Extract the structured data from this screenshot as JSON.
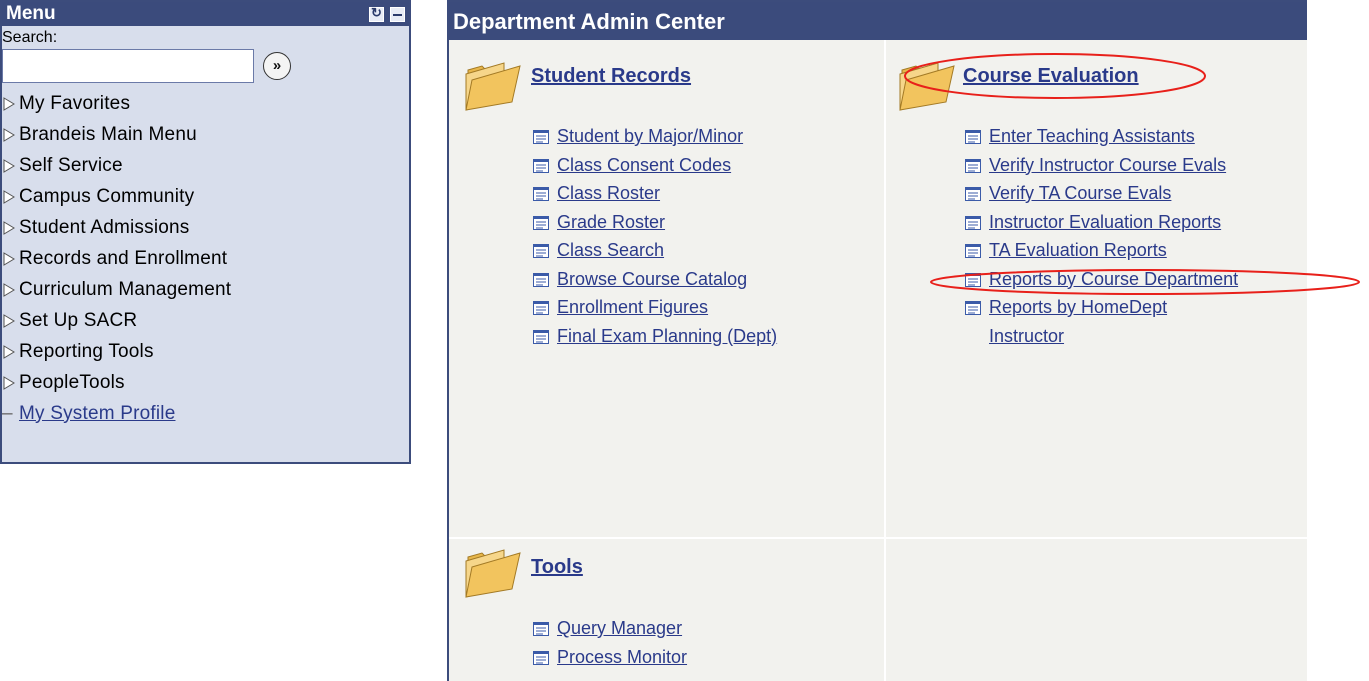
{
  "menu": {
    "title": "Menu",
    "search_label": "Search:",
    "search_value": "",
    "go_button": "»",
    "items": [
      {
        "label": "My Favorites"
      },
      {
        "label": "Brandeis Main Menu"
      },
      {
        "label": "Self Service"
      },
      {
        "label": "Campus Community"
      },
      {
        "label": "Student Admissions"
      },
      {
        "label": "Records and Enrollment"
      },
      {
        "label": "Curriculum Management"
      },
      {
        "label": "Set Up SACR"
      },
      {
        "label": "Reporting Tools"
      },
      {
        "label": "PeopleTools"
      }
    ],
    "profile_link": "My System Profile"
  },
  "admin": {
    "title": "Department Admin Center",
    "student_records": {
      "title": "Student Records",
      "links": [
        "Student by Major/Minor",
        "Class Consent Codes",
        "Class Roster",
        "Grade Roster",
        "Class Search",
        "Browse Course Catalog",
        "Enrollment Figures",
        "Final Exam Planning (Dept)"
      ]
    },
    "course_evaluation": {
      "title": "Course Evaluation",
      "links": [
        "Enter Teaching Assistants",
        "Verify Instructor Course Evals",
        "Verify TA Course Evals",
        "Instructor Evaluation Reports",
        "TA Evaluation Reports",
        "Reports by Course Department",
        "Reports by HomeDept Instructor"
      ]
    },
    "tools": {
      "title": "Tools",
      "links": [
        "Query Manager",
        "Process Monitor"
      ]
    }
  },
  "colors": {
    "header_bg": "#3b4b7c",
    "menu_bg": "#d8deec",
    "link": "#2a3a8a",
    "highlight": "#e8201a"
  },
  "icons": {
    "refresh": "refresh-icon",
    "minimize": "minimize-icon",
    "folder": "folder-icon",
    "page": "page-icon",
    "expand": "triangle-right-icon"
  }
}
